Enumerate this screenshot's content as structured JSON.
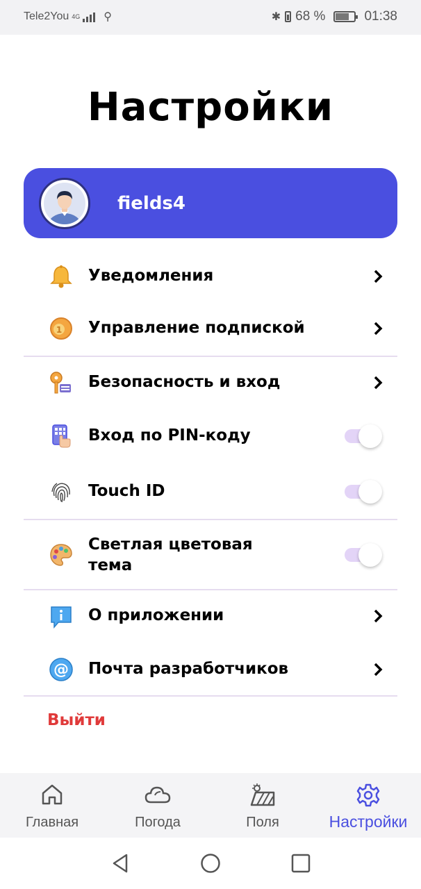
{
  "status_bar": {
    "carrier": "Tele2You",
    "network": "4G",
    "battery_percent": "68 %",
    "time": "01:38"
  },
  "header": {
    "title": "Настройки"
  },
  "profile": {
    "username": "fields4"
  },
  "settings": {
    "notifications": "Уведомления",
    "subscription": "Управление подпиской",
    "security": "Безопасность и вход",
    "pin_login": "Вход по PIN-коду",
    "touch_id": "Touch ID",
    "light_theme_line1": "Светлая цветовая",
    "light_theme_line2": "тема",
    "about": "О приложении",
    "dev_mail": "Почта разработчиков",
    "logout": "Выйти"
  },
  "toggles": {
    "pin_login_on": true,
    "touch_id_on": true,
    "light_theme_on": true
  },
  "tabbar": {
    "home": "Главная",
    "weather": "Погода",
    "fields": "Поля",
    "settings": "Настройки",
    "active": "settings"
  },
  "colors": {
    "accent": "#4a4fe0",
    "logout": "#e03a3a",
    "divider": "#e6dcef",
    "toggle_track": "#e3d4f7"
  }
}
